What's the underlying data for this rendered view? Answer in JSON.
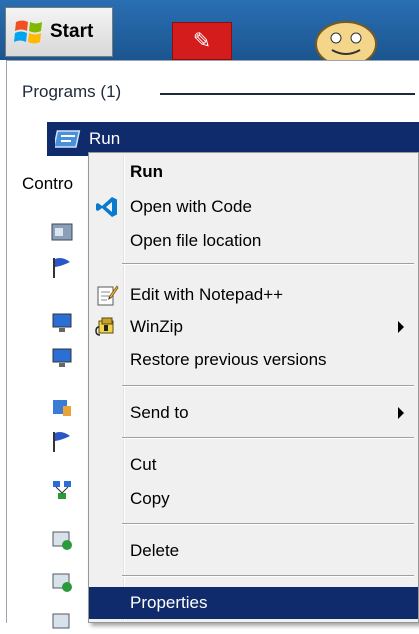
{
  "taskbar": {
    "start_label": "Start"
  },
  "start_menu": {
    "programs_header": "Programs (1)",
    "run_label": "Run",
    "control_header": "Contro"
  },
  "context_menu": {
    "items": [
      {
        "label": "Run",
        "icon": "none",
        "bold": true
      },
      {
        "label": "Open with Code",
        "icon": "vscode-icon"
      },
      {
        "label": "Open file location",
        "icon": "none"
      },
      {
        "label": "Edit with Notepad++",
        "icon": "notepad-plus-plus-icon"
      },
      {
        "label": "WinZip",
        "icon": "winzip-icon",
        "submenu": true
      },
      {
        "label": "Restore previous versions",
        "icon": "none"
      },
      {
        "label": "Send to",
        "icon": "none",
        "submenu": true
      },
      {
        "label": "Cut",
        "icon": "none"
      },
      {
        "label": "Copy",
        "icon": "none"
      },
      {
        "label": "Delete",
        "icon": "none"
      },
      {
        "label": "Properties",
        "icon": "none",
        "selected": true
      }
    ]
  },
  "colors": {
    "taskbar": "#1b5590",
    "highlight": "#0f2b6b",
    "menu_bg": "#f0f0f0"
  }
}
